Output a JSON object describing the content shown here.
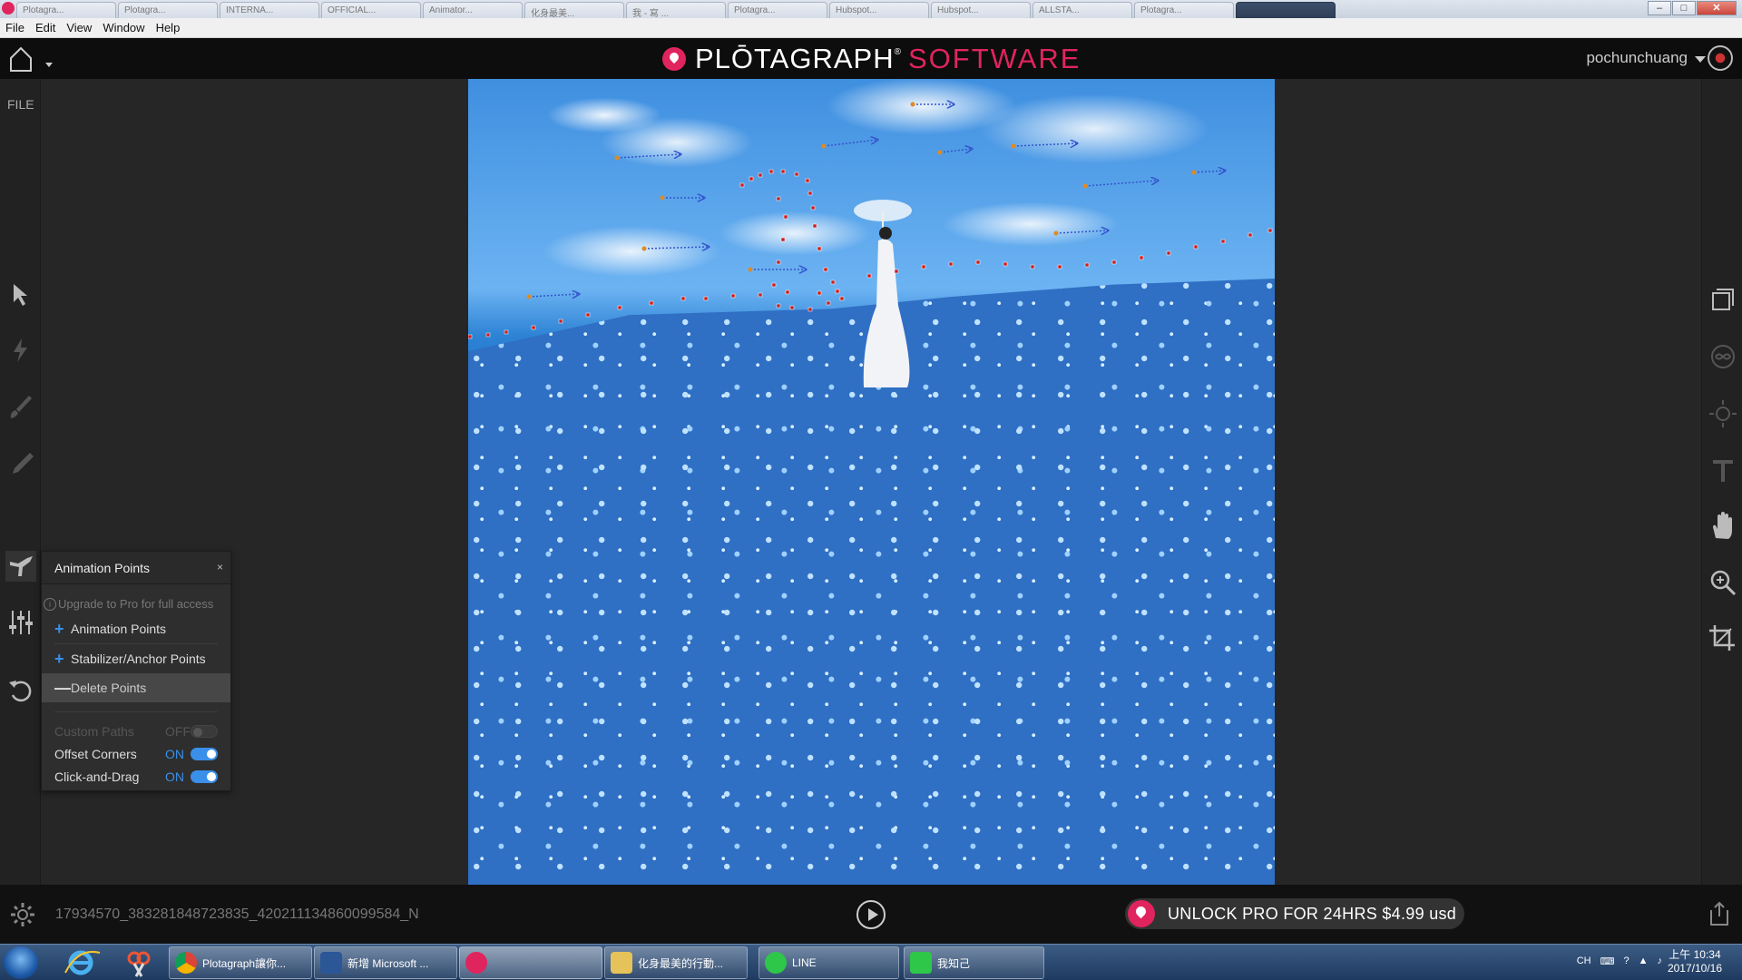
{
  "browser": {
    "tabs": [
      "Plotagra...",
      "Plotagra...",
      "INTERNA...",
      "OFFICIAL...",
      "Animator...",
      "化身最美...",
      "我 - 寫 ...",
      "Plotagra...",
      "Hubspot...",
      "Hubspot...",
      "ALLSTA...",
      "Plotagra..."
    ]
  },
  "menu": {
    "items": [
      "File",
      "Edit",
      "View",
      "Window",
      "Help"
    ]
  },
  "header": {
    "logo_primary": "PLŌTAGRAPH",
    "logo_reg": "®",
    "logo_secondary": "SOFTWARE",
    "username": "pochunchuang"
  },
  "left_toolbar": {
    "file_label": "FILE",
    "tools": [
      "select-arrow-icon",
      "lightning-icon",
      "brush-icon",
      "pen-icon",
      "animation-points-icon",
      "sliders-icon",
      "undo-icon"
    ]
  },
  "animation_panel": {
    "title": "Animation Points",
    "close": "×",
    "info_icon": "i",
    "upgrade_note": "Upgrade to Pro for full access",
    "items": [
      {
        "symbol": "+",
        "label": "Animation Points"
      },
      {
        "symbol": "+",
        "label": "Stabilizer/Anchor Points"
      },
      {
        "symbol": "—",
        "label": "Delete Points"
      }
    ],
    "settings": [
      {
        "label": "Custom Paths",
        "state": "OFF"
      },
      {
        "label": "Offset Corners",
        "state": "ON"
      },
      {
        "label": "Click-and-Drag",
        "state": "ON"
      }
    ]
  },
  "right_toolbar": {
    "tools": [
      "layers-icon",
      "loop-icon",
      "brightness-icon",
      "text-icon",
      "hand-icon",
      "zoom-icon",
      "crop-icon"
    ]
  },
  "bottom": {
    "filename": "17934570_383281848723835_420211134860099584_N",
    "unlock_text": "UNLOCK PRO FOR 24HRS $4.99 usd"
  },
  "taskbar": {
    "tasks": [
      {
        "label": "Plotagraph讓你...",
        "icon_color": "#e8b43a"
      },
      {
        "label": "新增 Microsoft ...",
        "icon_color": "#2b5797"
      },
      {
        "label": "",
        "icon_color": "#e0245e"
      },
      {
        "label": "化身最美的行動...",
        "icon_color": "#e6c35a"
      },
      {
        "label": "LINE",
        "icon_color": "#2ec74a"
      },
      {
        "label": "我知己",
        "icon_color": "#2ec74a"
      }
    ],
    "tray_lang": "CH",
    "clock_time": "上午 10:34",
    "clock_date": "2017/10/16"
  },
  "colors": {
    "brand": "#e0245e",
    "accent": "#3a8fe8"
  }
}
